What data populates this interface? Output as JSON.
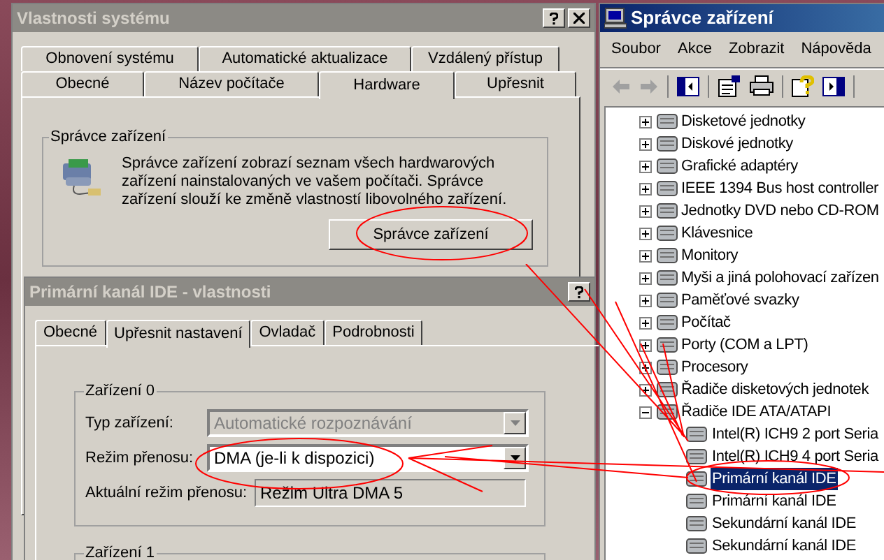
{
  "system_properties": {
    "title": "Vlastnosti systému",
    "tabs_back": [
      {
        "label": "Obnovení systému",
        "selected": false
      },
      {
        "label": "Automatické aktualizace",
        "selected": false
      },
      {
        "label": "Vzdálený přístup",
        "selected": false
      }
    ],
    "tabs_front": [
      {
        "label": "Obecné",
        "selected": false
      },
      {
        "label": "Název počítače",
        "selected": false
      },
      {
        "label": "Hardware",
        "selected": true
      },
      {
        "label": "Upřesnit",
        "selected": false
      }
    ],
    "group": {
      "title": "Správce zařízení",
      "text": "Správce zařízení zobrazí seznam všech hardwarových zařízení nainstalovaných ve vašem počítači. Správce zařízení slouží ke změně vlastností libovolného zařízení.",
      "button": "Správce zařízení"
    }
  },
  "ide_properties": {
    "title": "Primární kanál IDE - vlastnosti",
    "tabs": [
      {
        "label": "Obecné",
        "selected": false
      },
      {
        "label": "Upřesnit nastavení",
        "selected": true
      },
      {
        "label": "Ovladač",
        "selected": false
      },
      {
        "label": "Podrobnosti",
        "selected": false
      }
    ],
    "device_0": {
      "title": "Zařízení 0",
      "fields": [
        {
          "label": "Typ zařízení:",
          "kind": "combo",
          "value": "Automatické rozpoznávání",
          "disabled": true
        },
        {
          "label": "Režim přenosu:",
          "kind": "combo",
          "value": "DMA (je-li k dispozici)",
          "disabled": false
        },
        {
          "label": "Aktuální režim přenosu:",
          "kind": "readonly",
          "value": "Režim Ultra DMA 5"
        }
      ]
    },
    "device_1": {
      "title": "Zařízení 1"
    }
  },
  "device_manager": {
    "title": "Správce zařízení",
    "menu": [
      "Soubor",
      "Akce",
      "Zobrazit",
      "Nápověda"
    ],
    "tree": [
      {
        "label": "Disketové jednotky",
        "expanded": false
      },
      {
        "label": "Diskové jednotky",
        "expanded": false
      },
      {
        "label": "Grafické adaptéry",
        "expanded": false
      },
      {
        "label": "IEEE 1394 Bus host controller",
        "expanded": false
      },
      {
        "label": "Jednotky DVD nebo CD-ROM",
        "expanded": false
      },
      {
        "label": "Klávesnice",
        "expanded": false
      },
      {
        "label": "Monitory",
        "expanded": false
      },
      {
        "label": "Myši a jiná polohovací zařízen",
        "expanded": false
      },
      {
        "label": "Paměťové svazky",
        "expanded": false
      },
      {
        "label": "Počítač",
        "expanded": false
      },
      {
        "label": "Porty (COM a LPT)",
        "expanded": false
      },
      {
        "label": "Procesory",
        "expanded": false
      },
      {
        "label": "Řadiče disketových jednotek",
        "expanded": false
      },
      {
        "label": "Řadiče IDE ATA/ATAPI",
        "expanded": true,
        "children": [
          {
            "label": "Intel(R) ICH9 2 port Seria",
            "selected": false
          },
          {
            "label": "Intel(R) ICH9 4 port Seria",
            "selected": false
          },
          {
            "label": "Primární kanál IDE",
            "selected": true
          },
          {
            "label": "Primární kanál IDE",
            "selected": false
          },
          {
            "label": "Sekundární kanál IDE",
            "selected": false
          },
          {
            "label": "Sekundární kanál IDE",
            "selected": false
          }
        ]
      }
    ]
  }
}
